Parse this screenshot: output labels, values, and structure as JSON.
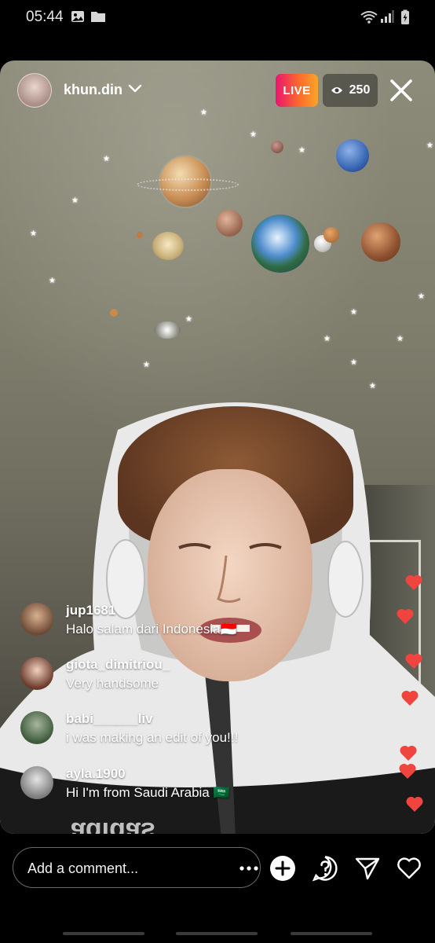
{
  "status_bar": {
    "time": "05:44",
    "left_icons": [
      "image-icon",
      "folder-icon"
    ],
    "right_icons": [
      "wifi-icon",
      "signal-icon",
      "battery-charging-icon"
    ]
  },
  "live": {
    "host_name": "khun.din",
    "live_label": "LIVE",
    "viewer_count": "250",
    "colors": {
      "live_gradient_start": "#e9156f",
      "live_gradient_end": "#f8a52a"
    }
  },
  "comments": [
    {
      "user": "jup1681",
      "text": "Halo salam dari Indonesia🇮🇩"
    },
    {
      "user": "giota_dimitriou_",
      "text": "Very handsome"
    },
    {
      "user": "babi______liv",
      "text": "i was making an edit of you!!!"
    },
    {
      "user": "ayla.1900",
      "text": "Hi I'm from Saudi Arabia 🇸🇦"
    }
  ],
  "reactions": {
    "heart_color": "#f0443f"
  },
  "bottom_bar": {
    "comment_placeholder": "Add a comment...",
    "buttons": [
      "more-icon",
      "add-icon",
      "question-icon",
      "send-icon",
      "heart-icon"
    ]
  }
}
